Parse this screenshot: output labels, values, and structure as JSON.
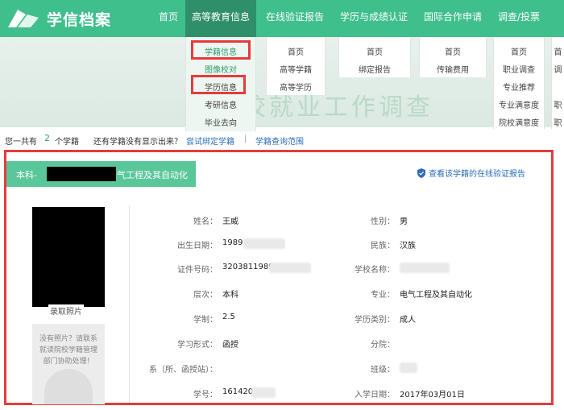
{
  "app": {
    "logo_text": "学信档案"
  },
  "nav": [
    "首页",
    "高等教育信息",
    "在线验证报告",
    "学历与成绩认证",
    "国际合作申请",
    "调查/投票"
  ],
  "dropdown_edu": [
    "学籍信息",
    "图像校对",
    "学历信息",
    "考研信息",
    "毕业去向"
  ],
  "submenu_cols": [
    [
      "首页",
      "高等学籍",
      "高等学历"
    ],
    [
      "首页",
      "绑定报告"
    ],
    [
      "首页",
      "传输费用"
    ],
    [
      "首页",
      "职业调查",
      "专业推荐",
      "专业满意度",
      "院校满意度"
    ],
    [
      "首",
      "调",
      "职",
      "职"
    ]
  ],
  "faded": {
    "banner_title": "校就业工作调查"
  },
  "info": {
    "prefix": "您一共有",
    "count": "2",
    "suffix": "个学籍",
    "question": "还有学籍没有显示出来？",
    "link1": "尝试绑定学籍",
    "sep": "|",
    "link2": "学籍查询范围"
  },
  "card": {
    "tab_prefix": "本科-",
    "tab_suffix": "气工程及其自动化",
    "verify_link": "查看该学籍的在线验证报告",
    "photo_label": "录取照片",
    "no_photo_text": "没有照片？请联系就读院校学籍管理部门协助处理！"
  },
  "fields_left": [
    {
      "label": "姓名：",
      "value": "王威"
    },
    {
      "label": "出生日期：",
      "value": "1989"
    },
    {
      "label": "证件号码：",
      "value": "3203811989"
    },
    {
      "label": "层次：",
      "value": "本科"
    },
    {
      "label": "学制：",
      "value": "2.5"
    },
    {
      "label": "学习形式：",
      "value": "函授"
    },
    {
      "label": "系（所、函授站）：",
      "value": ""
    },
    {
      "label": "学号：",
      "value": "161420"
    }
  ],
  "fields_right": [
    {
      "label": "性别：",
      "value": "男"
    },
    {
      "label": "民族：",
      "value": "汉族"
    },
    {
      "label": "学校名称：",
      "value": ""
    },
    {
      "label": "专业：",
      "value": "电气工程及其自动化"
    },
    {
      "label": "学历类别：",
      "value": "成人"
    },
    {
      "label": "分院：",
      "value": ""
    },
    {
      "label": "班级：",
      "value": ""
    },
    {
      "label": "入学日期：",
      "value": "2017年03月01日"
    }
  ],
  "colors": {
    "brand_green": "#3fbf8c",
    "nav_active": "#2f8f6a",
    "tab_green": "#5ac79a",
    "highlight_red": "#e53b3b",
    "link_blue": "#2a6ebb"
  }
}
